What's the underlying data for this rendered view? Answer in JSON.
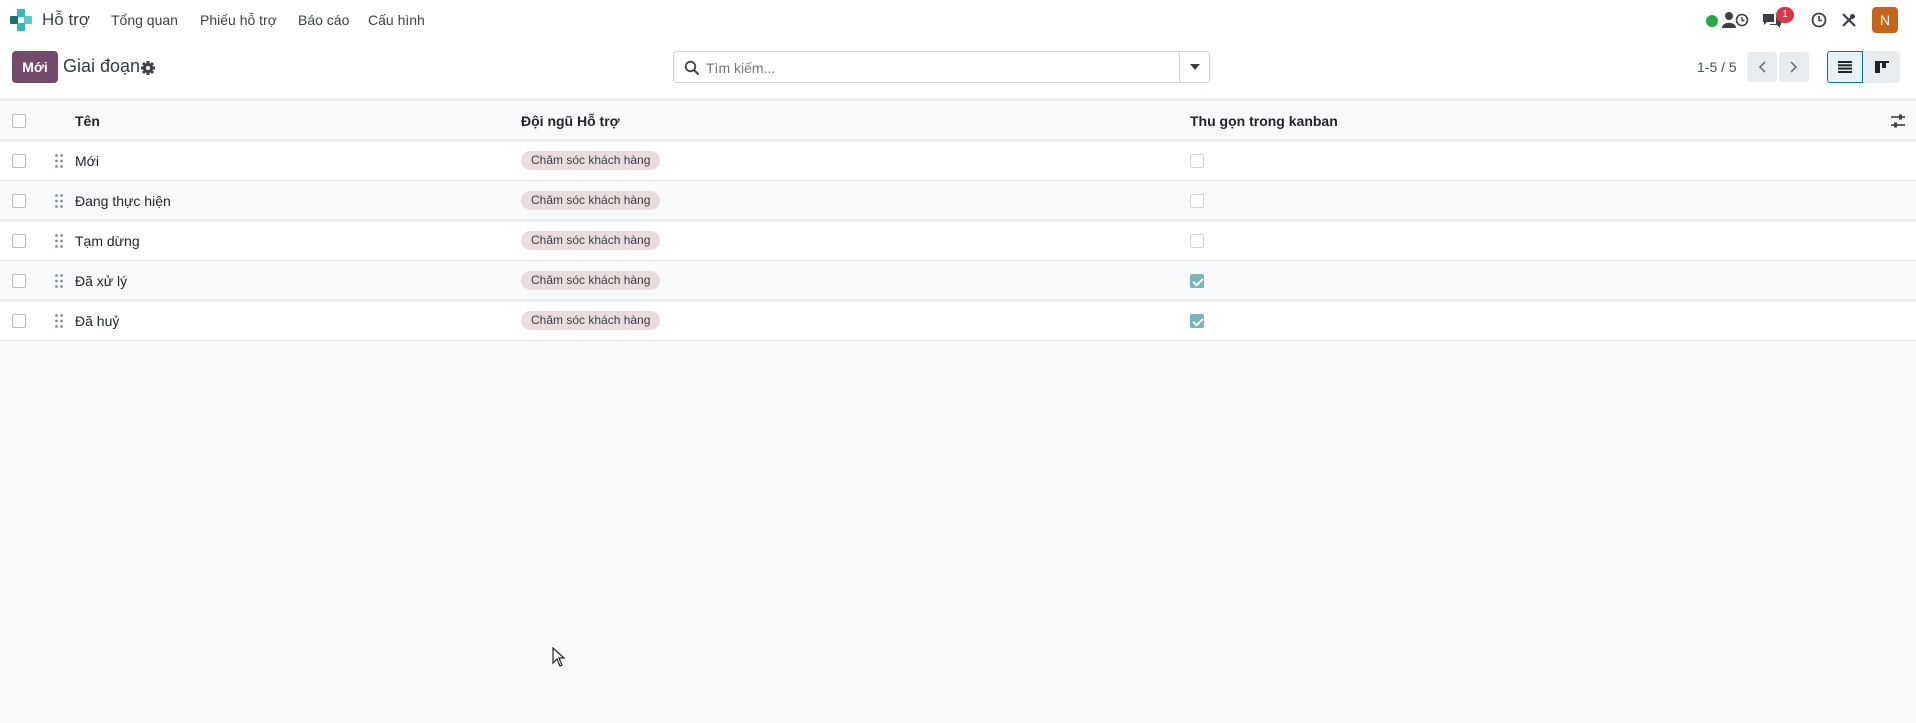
{
  "navbar": {
    "app_name": "Hỗ trợ",
    "menu": [
      "Tổng quan",
      "Phiếu hỗ trợ",
      "Báo cáo",
      "Cấu hình"
    ],
    "message_badge": "1",
    "avatar_letter": "N",
    "colors": {
      "presence": "#28a745",
      "badge": "#dc3545",
      "avatar": "#c8651b"
    },
    "icons": [
      "presence-dot-icon",
      "activity-icon",
      "messages-icon",
      "clock-icon",
      "tools-icon"
    ]
  },
  "control_panel": {
    "new_button": "Mới",
    "breadcrumb": "Giai đoạn",
    "search_placeholder": "Tìm kiếm...",
    "pager": "1-5 / 5",
    "accent": "#714b67"
  },
  "table": {
    "headers": {
      "name": "Tên",
      "team": "Đội ngũ Hỗ trợ",
      "fold": "Thu gọn trong kanban"
    },
    "rows": [
      {
        "name": "Mới",
        "team": "Chăm sóc khách hàng",
        "fold": false
      },
      {
        "name": "Đang thực hiện",
        "team": "Chăm sóc khách hàng",
        "fold": false
      },
      {
        "name": "Tạm dừng",
        "team": "Chăm sóc khách hàng",
        "fold": false
      },
      {
        "name": "Đã xử lý",
        "team": "Chăm sóc khách hàng",
        "fold": true
      },
      {
        "name": "Đã huỷ",
        "team": "Chăm sóc khách hàng",
        "fold": true
      }
    ]
  }
}
